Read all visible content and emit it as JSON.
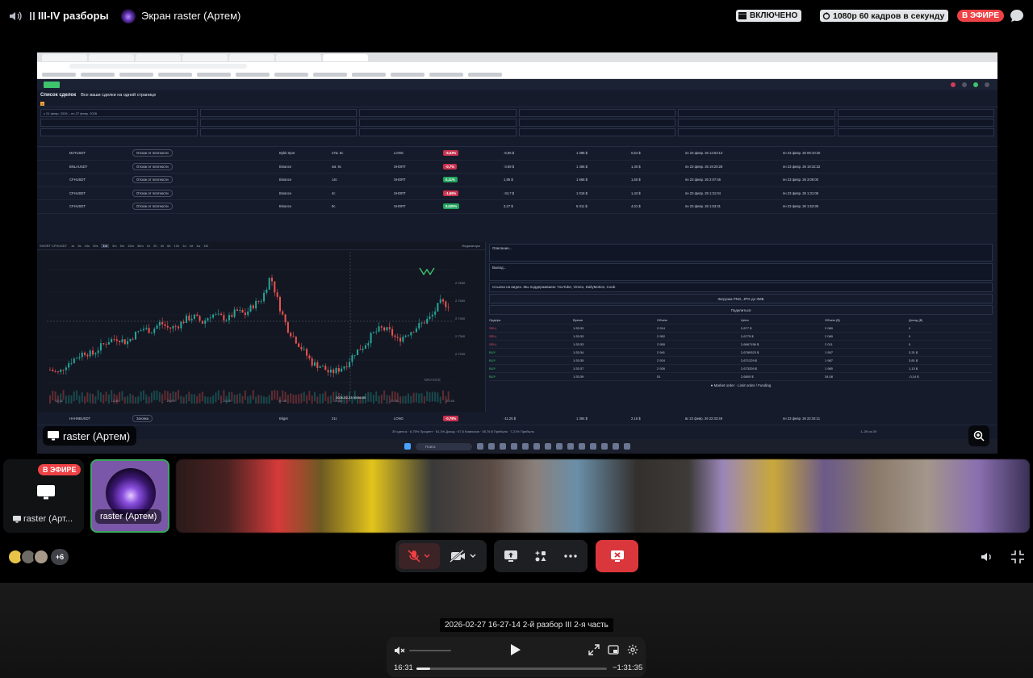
{
  "topbar": {
    "channel_name": "III-IV разборы",
    "stream_name": "Экран raster (Артем)",
    "enabled_label": "ВКЛЮЧЕНО",
    "quality_label": "1080р 60 кадров в секунду",
    "live_label": "В ЭФИРЕ"
  },
  "stream": {
    "title": "Список сделок",
    "subtitle": "Все ваши сделки на одной странице",
    "date_range": "с 21 февр. 2026 – по 27 февр. 2026",
    "trades": [
      {
        "ticker": "MATUSDT",
        "reason": "Отскок от плотности",
        "api": "Bybit Spot",
        "time": "47м. 5с",
        "side": "LONG",
        "result": "-5,03%",
        "result_positive": false,
        "pnl": "-6,95 $",
        "volume": "1 088 $",
        "commission": "0,54 $",
        "entry": "пн 23 февр. 26 13:53:13",
        "exit": "пн 23 февр. 26 09:10:20"
      },
      {
        "ticker": "BNLAUSDT",
        "reason": "Отскок от плотности",
        "api": "Binance",
        "time": "4м. 9с",
        "side": "SHORT",
        "result": "-0,7%",
        "result_positive": false,
        "pnl": "-3,89 $",
        "volume": "1 465 $",
        "commission": "1,40 $",
        "entry": "пн 23 февр. 26 19:20:28",
        "exit": "пн 23 февр. 26 19:32:32"
      },
      {
        "ticker": "CFHUSDT",
        "reason": "Отскок от плотности",
        "api": "Binance",
        "time": "14с",
        "side": "SHORT",
        "result": "0,11%",
        "result_positive": true,
        "pnl": "1,95 $",
        "volume": "1 668 $",
        "commission": "1,60 $",
        "entry": "пн 23 февр. 26 2:07:46",
        "exit": "пн 23 февр. 26 3:08:00"
      },
      {
        "ticker": "CFHUSDT",
        "reason": "Отскок от плотности",
        "api": "Binance",
        "time": "4с",
        "side": "SHORT",
        "result": "-1,65%",
        "result_positive": false,
        "pnl": "-34,7 $",
        "volume": "1 016 $",
        "commission": "1,42 $",
        "entry": "пн 23 февр. 26 1:31:04",
        "exit": "пн 23 февр. 26 1:31:08"
      },
      {
        "ticker": "CFHUSDT",
        "reason": "Отскок от плотности",
        "api": "Binance",
        "time": "9с",
        "side": "SHORT",
        "result": "0,020%",
        "result_positive": true,
        "pnl": "3,27 $",
        "volume": "5 011 $",
        "commission": "4,01 $",
        "entry": "пн 23 февр. 26 1:53:31",
        "exit": "пн 23 февр. 26 1:53:39"
      }
    ],
    "last_trade": {
      "ticker": "HAHNBUSDT",
      "reason": "Заговка",
      "api": "Bitget",
      "time": "21с",
      "side": "LONG",
      "result": "-0,79%",
      "pnl": "-11,25 $",
      "volume": "1 384 $",
      "commission": "2,16 $",
      "entry": "вс 22 февр. 26 22:33:49",
      "exit": "пн 23 февр. 26 22:34:11"
    },
    "chart_pair": "SHORT CFHUSDT",
    "indicators_label": "Индикаторы",
    "timeframes": [
      "1s",
      "5s",
      "15s",
      "30s",
      "1m",
      "3m",
      "5m",
      "15m",
      "30m",
      "1h",
      "2h",
      "4h",
      "6h",
      "12h",
      "1d",
      "3d",
      "1w",
      "1M"
    ],
    "active_timeframe": "1m",
    "price_labels": [
      "2.7600",
      "2.7500",
      "2.7400",
      "2.7300",
      "2.7200"
    ],
    "chart_time_labels": [
      "12:10",
      "12:30",
      "20:00",
      "20:20",
      "20:40",
      "21:00",
      "21:20",
      "21:40"
    ],
    "crosshair_time": "2026-02-23 00:56:00",
    "exchange_watermark": "BINANCE",
    "description_placeholder": "Описание...",
    "conclusion_placeholder": "Вывод...",
    "link_placeholder": "Ссылка на видео. Мы поддерживаем: YouTube, Vimeo, DailyMotion, Coub",
    "upload_label": "Загрузка PNG, JPG до 3МБ",
    "share_label": "Поделиться",
    "orders_headers": [
      "Ордера",
      "Время",
      "Объем",
      "Цена",
      "Объем ($)",
      "Доход ($)"
    ],
    "orders": [
      [
        "SELL",
        "1:33:33",
        "2 914",
        "2,677 $",
        "2 080",
        "0"
      ],
      [
        "SELL",
        "1:33:33",
        "2 952",
        "2,6775 $",
        "2 080",
        "0"
      ],
      [
        "SELL",
        "1:33:33",
        "2 950",
        "2,6667156 $",
        "2 011",
        "0"
      ],
      [
        "BUY",
        "1:33:34",
        "2 941",
        "2,6789323 $",
        "1 597",
        "3,31 $"
      ],
      [
        "BUY",
        "1:33:35",
        "2 924",
        "2,671229 $",
        "1 987",
        "3,81 $"
      ],
      [
        "BUY",
        "1:33:37",
        "2 926",
        "2,673326 $",
        "1 980",
        "1,13 $"
      ],
      [
        "BUY",
        "1:33:39",
        "51",
        "2,6800 $",
        "34,08",
        "-0,14 $"
      ]
    ],
    "legend_market": "Market order",
    "legend_limit": "Limit order / Funding",
    "footer_stats": "39 сделок · 6,75% Процент · 61,1% Доход · 67,5 Комиссия · 55,76 $ Прибыль · 7,21% Прибыль",
    "pager": "1–39 из 39",
    "taskbar_search": "Поиск"
  },
  "stream_name_tag": "raster (Артем)",
  "participants": {
    "screen_tile_live": "В ЭФИРЕ",
    "screen_tile_label": "raster (Арт...",
    "user_tile_label": "raster (Артем)",
    "extra_count": "+6"
  },
  "player": {
    "recording_title": "2026-02-27 16-27-14 2-й разбор III 2-я часть",
    "current_time": "16:31",
    "remaining_time": "−1:31:35",
    "progress": 0.072
  },
  "colors": {
    "live_red": "#ed4245",
    "hangup_red": "#da373c",
    "speaking_green": "#3ba55c",
    "profit_green": "#22a45d",
    "loss_red": "#c8324f"
  }
}
